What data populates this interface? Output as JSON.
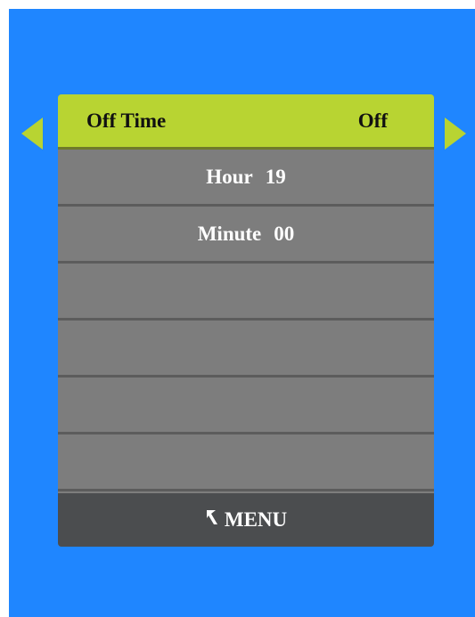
{
  "nav": {
    "left_icon": "left-triangle-icon",
    "right_icon": "right-triangle-icon",
    "arrow_color": "#b8d432"
  },
  "menu": {
    "title": "Off Time",
    "value": "Off",
    "rows": [
      {
        "label": "Hour",
        "value": "19"
      },
      {
        "label": "Minute",
        "value": "00"
      }
    ],
    "footer_label": "MENU",
    "footer_icon": "return-arrow-icon"
  },
  "colors": {
    "background": "#1f86ff",
    "header": "#b8d432",
    "row": "#7d7d7d",
    "footer": "#4b4d4f"
  }
}
